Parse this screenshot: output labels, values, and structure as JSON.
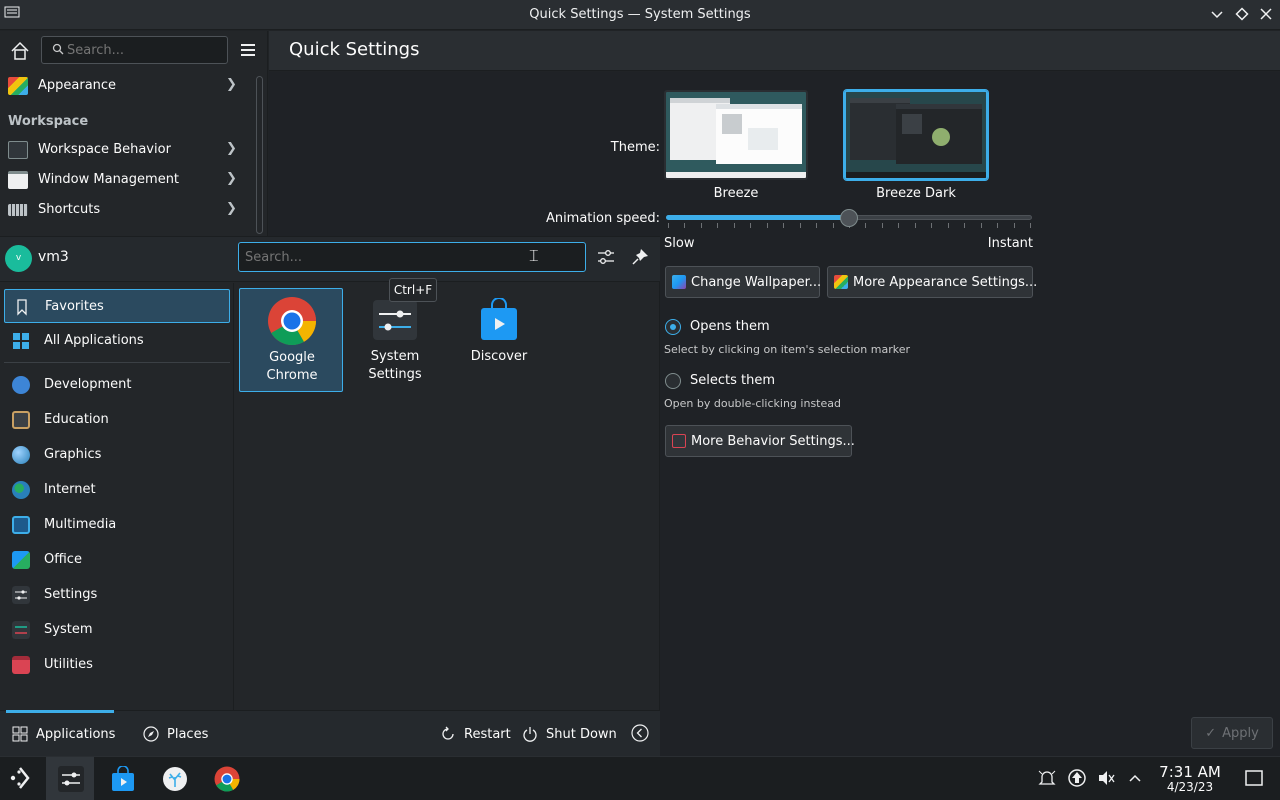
{
  "window": {
    "title": "Quick Settings — System Settings"
  },
  "sidebar": {
    "search_placeholder": "Search...",
    "items": [
      {
        "label": "Appearance",
        "icon": "appearance-icon"
      },
      {
        "label": "Workspace Behavior",
        "icon": "workspace-behavior-icon"
      },
      {
        "label": "Window Management",
        "icon": "window-management-icon"
      },
      {
        "label": "Shortcuts",
        "icon": "keyboard-icon"
      }
    ],
    "section_workspace": "Workspace"
  },
  "main": {
    "title": "Quick Settings",
    "theme_label": "Theme:",
    "themes": [
      {
        "name": "Breeze",
        "selected": false
      },
      {
        "name": "Breeze Dark",
        "selected": true
      }
    ],
    "animation_label": "Animation speed:",
    "animation_value_fraction": 0.5,
    "slow_label": "Slow",
    "instant_label": "Instant",
    "change_wallpaper": "Change Wallpaper...",
    "more_appearance": "More Appearance Settings...",
    "click_option_1": "Opens them",
    "click_option_1_hint": "Select by clicking on item's selection marker",
    "click_option_2": "Selects them",
    "click_option_2_hint": "Open by double-clicking instead",
    "more_behavior": "More Behavior Settings...",
    "apply": "Apply"
  },
  "launcher": {
    "username": "vm3",
    "avatar_letter": "v",
    "search_placeholder": "Search...",
    "tooltip": "Ctrl+F",
    "categories": [
      {
        "label": "Favorites",
        "selected": true,
        "icon": "bookmark-icon"
      },
      {
        "label": "All Applications",
        "selected": false,
        "icon": "grid-icon"
      },
      {
        "label": "Development",
        "icon": "development-icon"
      },
      {
        "label": "Education",
        "icon": "education-icon"
      },
      {
        "label": "Graphics",
        "icon": "graphics-icon"
      },
      {
        "label": "Internet",
        "icon": "globe-icon"
      },
      {
        "label": "Multimedia",
        "icon": "multimedia-icon"
      },
      {
        "label": "Office",
        "icon": "office-icon"
      },
      {
        "label": "Settings",
        "icon": "settings-icon"
      },
      {
        "label": "System",
        "icon": "system-icon"
      },
      {
        "label": "Utilities",
        "icon": "utilities-icon"
      }
    ],
    "apps": [
      {
        "line1": "Google",
        "line2": "Chrome"
      },
      {
        "line1": "System",
        "line2": "Settings"
      },
      {
        "line1": "Discover",
        "line2": ""
      }
    ],
    "tabs": {
      "applications": "Applications",
      "places": "Places"
    },
    "restart": "Restart",
    "shutdown": "Shut Down"
  },
  "taskbar": {
    "time": "7:31 AM",
    "date": "4/23/23"
  },
  "colors": {
    "accent": "#3daee9",
    "bg": "#232629"
  }
}
